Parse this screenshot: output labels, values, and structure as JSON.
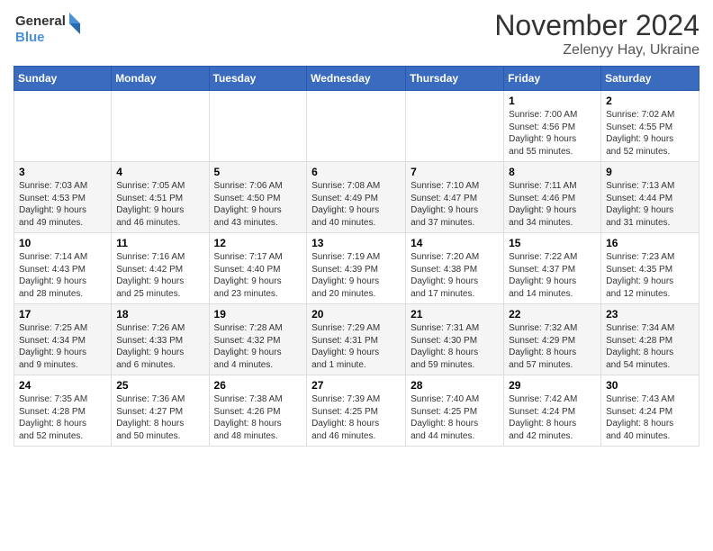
{
  "logo": {
    "line1": "General",
    "line2": "Blue"
  },
  "header": {
    "month": "November 2024",
    "location": "Zelenyy Hay, Ukraine"
  },
  "weekdays": [
    "Sunday",
    "Monday",
    "Tuesday",
    "Wednesday",
    "Thursday",
    "Friday",
    "Saturday"
  ],
  "weeks": [
    [
      {
        "day": "",
        "info": ""
      },
      {
        "day": "",
        "info": ""
      },
      {
        "day": "",
        "info": ""
      },
      {
        "day": "",
        "info": ""
      },
      {
        "day": "",
        "info": ""
      },
      {
        "day": "1",
        "info": "Sunrise: 7:00 AM\nSunset: 4:56 PM\nDaylight: 9 hours\nand 55 minutes."
      },
      {
        "day": "2",
        "info": "Sunrise: 7:02 AM\nSunset: 4:55 PM\nDaylight: 9 hours\nand 52 minutes."
      }
    ],
    [
      {
        "day": "3",
        "info": "Sunrise: 7:03 AM\nSunset: 4:53 PM\nDaylight: 9 hours\nand 49 minutes."
      },
      {
        "day": "4",
        "info": "Sunrise: 7:05 AM\nSunset: 4:51 PM\nDaylight: 9 hours\nand 46 minutes."
      },
      {
        "day": "5",
        "info": "Sunrise: 7:06 AM\nSunset: 4:50 PM\nDaylight: 9 hours\nand 43 minutes."
      },
      {
        "day": "6",
        "info": "Sunrise: 7:08 AM\nSunset: 4:49 PM\nDaylight: 9 hours\nand 40 minutes."
      },
      {
        "day": "7",
        "info": "Sunrise: 7:10 AM\nSunset: 4:47 PM\nDaylight: 9 hours\nand 37 minutes."
      },
      {
        "day": "8",
        "info": "Sunrise: 7:11 AM\nSunset: 4:46 PM\nDaylight: 9 hours\nand 34 minutes."
      },
      {
        "day": "9",
        "info": "Sunrise: 7:13 AM\nSunset: 4:44 PM\nDaylight: 9 hours\nand 31 minutes."
      }
    ],
    [
      {
        "day": "10",
        "info": "Sunrise: 7:14 AM\nSunset: 4:43 PM\nDaylight: 9 hours\nand 28 minutes."
      },
      {
        "day": "11",
        "info": "Sunrise: 7:16 AM\nSunset: 4:42 PM\nDaylight: 9 hours\nand 25 minutes."
      },
      {
        "day": "12",
        "info": "Sunrise: 7:17 AM\nSunset: 4:40 PM\nDaylight: 9 hours\nand 23 minutes."
      },
      {
        "day": "13",
        "info": "Sunrise: 7:19 AM\nSunset: 4:39 PM\nDaylight: 9 hours\nand 20 minutes."
      },
      {
        "day": "14",
        "info": "Sunrise: 7:20 AM\nSunset: 4:38 PM\nDaylight: 9 hours\nand 17 minutes."
      },
      {
        "day": "15",
        "info": "Sunrise: 7:22 AM\nSunset: 4:37 PM\nDaylight: 9 hours\nand 14 minutes."
      },
      {
        "day": "16",
        "info": "Sunrise: 7:23 AM\nSunset: 4:35 PM\nDaylight: 9 hours\nand 12 minutes."
      }
    ],
    [
      {
        "day": "17",
        "info": "Sunrise: 7:25 AM\nSunset: 4:34 PM\nDaylight: 9 hours\nand 9 minutes."
      },
      {
        "day": "18",
        "info": "Sunrise: 7:26 AM\nSunset: 4:33 PM\nDaylight: 9 hours\nand 6 minutes."
      },
      {
        "day": "19",
        "info": "Sunrise: 7:28 AM\nSunset: 4:32 PM\nDaylight: 9 hours\nand 4 minutes."
      },
      {
        "day": "20",
        "info": "Sunrise: 7:29 AM\nSunset: 4:31 PM\nDaylight: 9 hours\nand 1 minute."
      },
      {
        "day": "21",
        "info": "Sunrise: 7:31 AM\nSunset: 4:30 PM\nDaylight: 8 hours\nand 59 minutes."
      },
      {
        "day": "22",
        "info": "Sunrise: 7:32 AM\nSunset: 4:29 PM\nDaylight: 8 hours\nand 57 minutes."
      },
      {
        "day": "23",
        "info": "Sunrise: 7:34 AM\nSunset: 4:28 PM\nDaylight: 8 hours\nand 54 minutes."
      }
    ],
    [
      {
        "day": "24",
        "info": "Sunrise: 7:35 AM\nSunset: 4:28 PM\nDaylight: 8 hours\nand 52 minutes."
      },
      {
        "day": "25",
        "info": "Sunrise: 7:36 AM\nSunset: 4:27 PM\nDaylight: 8 hours\nand 50 minutes."
      },
      {
        "day": "26",
        "info": "Sunrise: 7:38 AM\nSunset: 4:26 PM\nDaylight: 8 hours\nand 48 minutes."
      },
      {
        "day": "27",
        "info": "Sunrise: 7:39 AM\nSunset: 4:25 PM\nDaylight: 8 hours\nand 46 minutes."
      },
      {
        "day": "28",
        "info": "Sunrise: 7:40 AM\nSunset: 4:25 PM\nDaylight: 8 hours\nand 44 minutes."
      },
      {
        "day": "29",
        "info": "Sunrise: 7:42 AM\nSunset: 4:24 PM\nDaylight: 8 hours\nand 42 minutes."
      },
      {
        "day": "30",
        "info": "Sunrise: 7:43 AM\nSunset: 4:24 PM\nDaylight: 8 hours\nand 40 minutes."
      }
    ]
  ]
}
